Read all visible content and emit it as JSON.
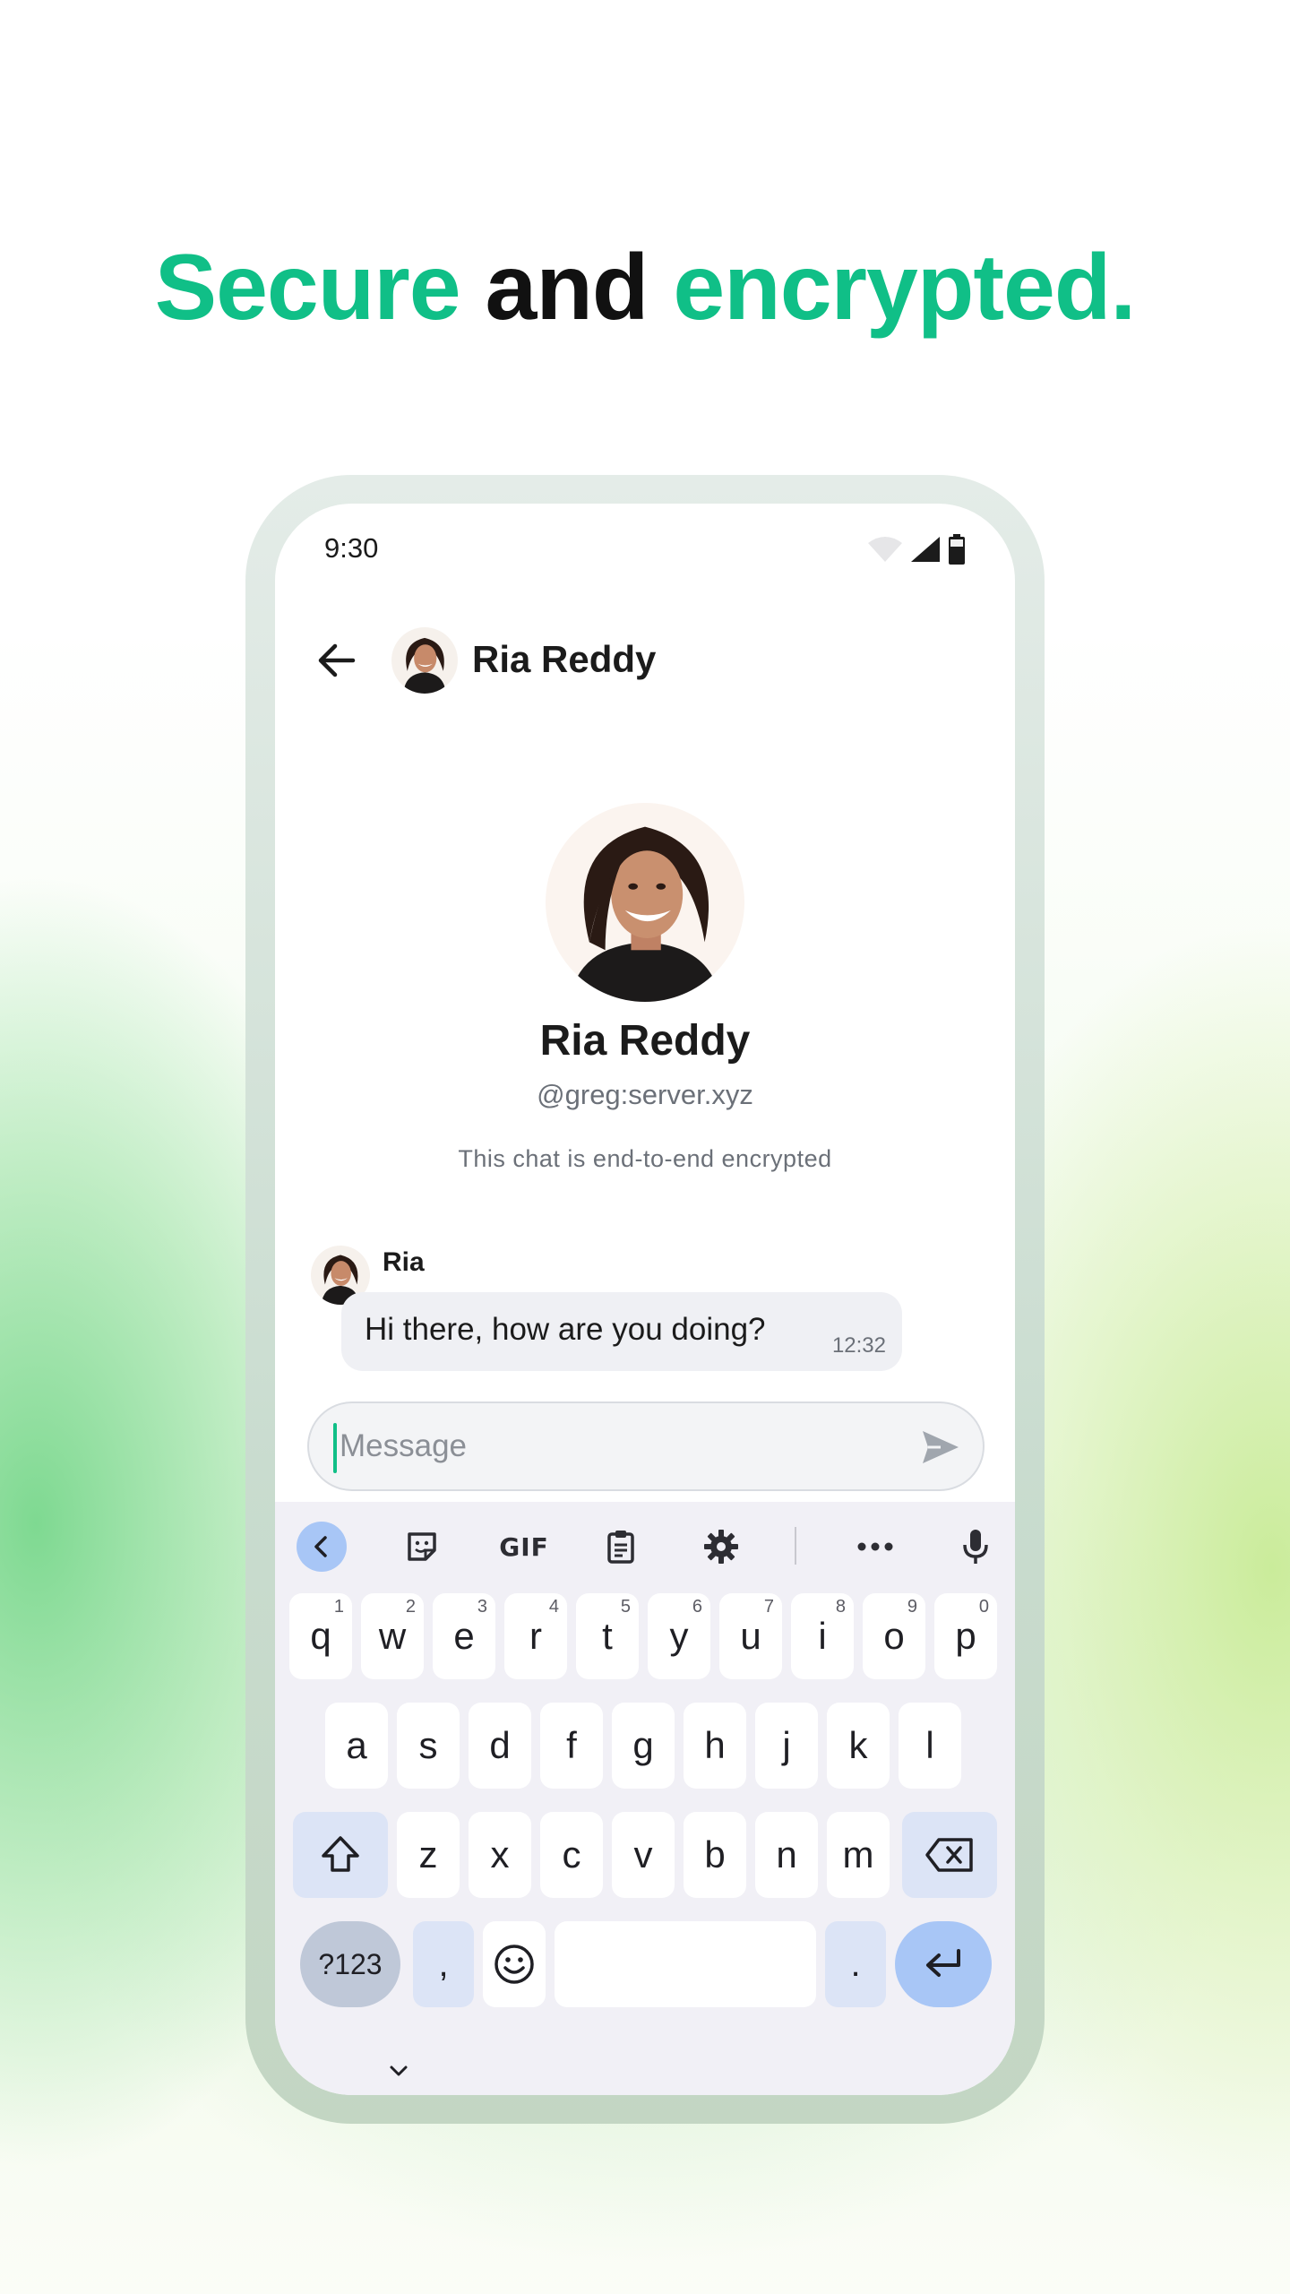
{
  "headline": {
    "part1": "Secure",
    "part2": "and",
    "part3": "encrypted."
  },
  "colors": {
    "accent": "#10bf87",
    "bubble": "#eff0f4",
    "keyboard_bg": "#f1f0f6",
    "enter_key": "#a8c6f6"
  },
  "status_bar": {
    "time": "9:30",
    "icons": [
      "wifi-icon",
      "signal-icon",
      "battery-icon"
    ]
  },
  "top_bar": {
    "title": "Ria Reddy",
    "back_icon": "arrow-left-icon"
  },
  "profile": {
    "name": "Ria Reddy",
    "handle": "@greg:server.xyz",
    "encryption_note": "This chat is end-to-end encrypted"
  },
  "messages": [
    {
      "sender": "Ria",
      "text": "Hi there, how are you doing?",
      "time": "12:32"
    }
  ],
  "composer": {
    "placeholder": "Message",
    "send_icon": "send-icon"
  },
  "keyboard": {
    "toolbar": {
      "gif_label": "GIF",
      "icons": [
        "chevron-left-icon",
        "sticker-icon",
        "gif-icon",
        "clipboard-icon",
        "gear-icon",
        "more-icon",
        "mic-icon"
      ]
    },
    "row1": [
      {
        "key": "q",
        "hint": "1"
      },
      {
        "key": "w",
        "hint": "2"
      },
      {
        "key": "e",
        "hint": "3"
      },
      {
        "key": "r",
        "hint": "4"
      },
      {
        "key": "t",
        "hint": "5"
      },
      {
        "key": "y",
        "hint": "6"
      },
      {
        "key": "u",
        "hint": "7"
      },
      {
        "key": "i",
        "hint": "8"
      },
      {
        "key": "o",
        "hint": "9"
      },
      {
        "key": "p",
        "hint": "0"
      }
    ],
    "row2": [
      "a",
      "s",
      "d",
      "f",
      "g",
      "h",
      "j",
      "k",
      "l"
    ],
    "row3": [
      "z",
      "x",
      "c",
      "v",
      "b",
      "n",
      "m"
    ],
    "row4": {
      "symbols": "?123",
      "comma": ",",
      "period": "."
    }
  }
}
